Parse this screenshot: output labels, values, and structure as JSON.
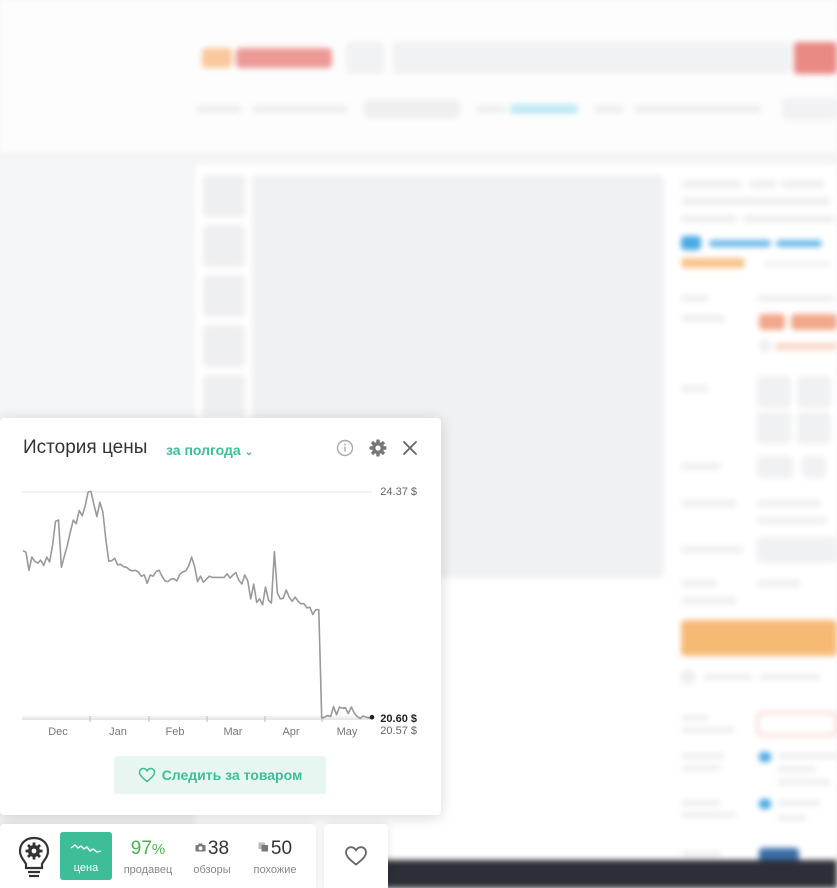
{
  "popup": {
    "title": "История цены",
    "period_label": "за полгода",
    "follow_label": "Следить за товаром"
  },
  "chart_data": {
    "type": "line",
    "x_labels": [
      "Dec",
      "Jan",
      "Feb",
      "Mar",
      "Apr",
      "May"
    ],
    "y_labels": [
      "24.37 $",
      "20.60 $",
      "20.57 $"
    ],
    "current_price": "20.60 $",
    "ylim": [
      20.57,
      24.37
    ],
    "series": [
      {
        "values": [
          23.39,
          23.36,
          23.06,
          23.28,
          23.21,
          23.18,
          23.23,
          23.14,
          23.28,
          23.2,
          23.48,
          23.88,
          23.9,
          23.11,
          23.3,
          23.48,
          23.7,
          23.9,
          23.84,
          24.06,
          23.97,
          24.13,
          24.37,
          24.38,
          24.15,
          23.96,
          24.2,
          24.03,
          23.58,
          23.21,
          23.22,
          23.26,
          23.15,
          23.16,
          23.12,
          23.11,
          23.07,
          23.05,
          23.06,
          23.03,
          22.96,
          22.98,
          22.84,
          22.98,
          22.96,
          23.04,
          23.06,
          22.96,
          22.88,
          22.87,
          22.91,
          22.92,
          22.88,
          22.99,
          23.03,
          23.05,
          23.13,
          23.28,
          23.13,
          22.87,
          22.96,
          22.86,
          22.91,
          22.96,
          22.94,
          22.94,
          22.94,
          22.94,
          22.94,
          23.0,
          22.93,
          22.98,
          23.02,
          22.89,
          22.83,
          22.98,
          22.88,
          22.58,
          22.83,
          22.52,
          22.58,
          22.48,
          22.78,
          22.56,
          22.51,
          23.37,
          22.68,
          22.58,
          22.59,
          22.73,
          22.61,
          22.54,
          22.61,
          22.54,
          22.5,
          22.5,
          22.43,
          22.44,
          22.32,
          22.4,
          22.4,
          20.59,
          20.6,
          20.63,
          20.61,
          20.78,
          20.64,
          20.77,
          20.75,
          20.76,
          20.66,
          20.77,
          20.67,
          20.61,
          20.58,
          20.62,
          20.6,
          20.59,
          20.6
        ]
      }
    ]
  },
  "toolbar": {
    "price_label": "цена",
    "seller_value": "97",
    "seller_unit": "%",
    "seller_label": "продавец",
    "reviews_value": "38",
    "reviews_label": "обзоры",
    "similar_value": "50",
    "similar_label": "похожие"
  },
  "colors": {
    "accent": "#3dbd98",
    "accent_light": "#e8f6f1",
    "chart_line": "#999999",
    "seller_value": "#4caf50"
  },
  "icons": {
    "info": "info-circle-icon",
    "settings": "gear-icon",
    "close": "close-icon",
    "heart": "heart-outline-icon",
    "logo": "lightbulb-gear-icon",
    "camera": "camera-icon",
    "similar": "copy-icon"
  }
}
